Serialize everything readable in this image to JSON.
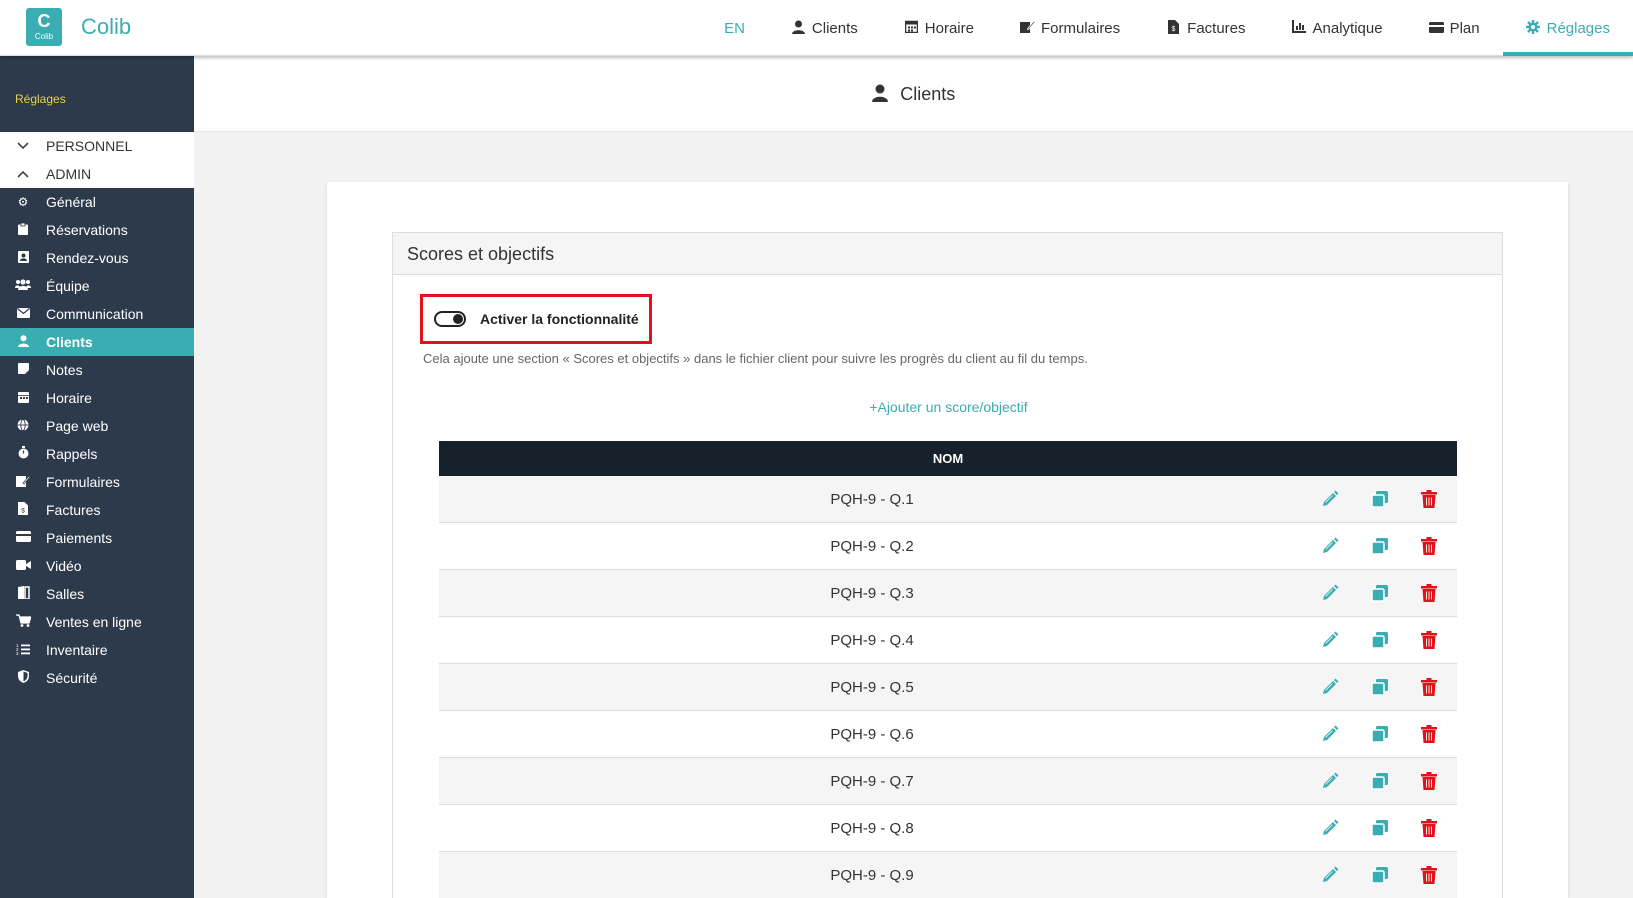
{
  "app": {
    "brand": "Colib",
    "logo_letter": "C",
    "logo_text": "Colib",
    "accent_color": "#3aadb3",
    "danger_color": "#e0131a"
  },
  "topnav": {
    "lang": "EN",
    "items": [
      {
        "label": "Clients",
        "icon": "user-icon"
      },
      {
        "label": "Horaire",
        "icon": "calendar-icon"
      },
      {
        "label": "Formulaires",
        "icon": "form-icon"
      },
      {
        "label": "Factures",
        "icon": "invoice-icon"
      },
      {
        "label": "Analytique",
        "icon": "chart-icon"
      },
      {
        "label": "Plan",
        "icon": "credit-card-icon"
      },
      {
        "label": "Réglages",
        "icon": "gear-icon",
        "active": true
      }
    ]
  },
  "sidebar": {
    "header": "Réglages",
    "groups": {
      "personnel": "PERSONNEL",
      "admin": "ADMIN"
    },
    "items": [
      {
        "label": "Général",
        "icon": "gear-icon"
      },
      {
        "label": "Réservations",
        "icon": "clipboard-icon"
      },
      {
        "label": "Rendez-vous",
        "icon": "contact-card-icon"
      },
      {
        "label": "Équipe",
        "icon": "team-icon"
      },
      {
        "label": "Communication",
        "icon": "envelope-icon"
      },
      {
        "label": "Clients",
        "icon": "user-icon",
        "active": true
      },
      {
        "label": "Notes",
        "icon": "note-icon"
      },
      {
        "label": "Horaire",
        "icon": "calendar-icon"
      },
      {
        "label": "Page web",
        "icon": "globe-icon"
      },
      {
        "label": "Rappels",
        "icon": "stopwatch-icon"
      },
      {
        "label": "Formulaires",
        "icon": "form-icon"
      },
      {
        "label": "Factures",
        "icon": "invoice-icon"
      },
      {
        "label": "Paiements",
        "icon": "credit-card-icon"
      },
      {
        "label": "Vidéo",
        "icon": "video-icon"
      },
      {
        "label": "Salles",
        "icon": "door-icon"
      },
      {
        "label": "Ventes en ligne",
        "icon": "cart-icon"
      },
      {
        "label": "Inventaire",
        "icon": "list-icon"
      },
      {
        "label": "Sécurité",
        "icon": "shield-icon"
      }
    ]
  },
  "page": {
    "title": "Clients"
  },
  "panel": {
    "title": "Scores et objectifs",
    "toggle_label": "Activer la fonctionnalité",
    "toggle_on": true,
    "help": "Cela ajoute une section « Scores et objectifs » dans le fichier client pour suivre les progrès du client au fil du temps.",
    "add_link": "+Ajouter un score/objectif",
    "table": {
      "header": "NOM",
      "rows": [
        "PQH-9 - Q.1",
        "PQH-9 - Q.2",
        "PQH-9 - Q.3",
        "PQH-9 - Q.4",
        "PQH-9 - Q.5",
        "PQH-9 - Q.6",
        "PQH-9 - Q.7",
        "PQH-9 - Q.8",
        "PQH-9 - Q.9"
      ]
    }
  }
}
